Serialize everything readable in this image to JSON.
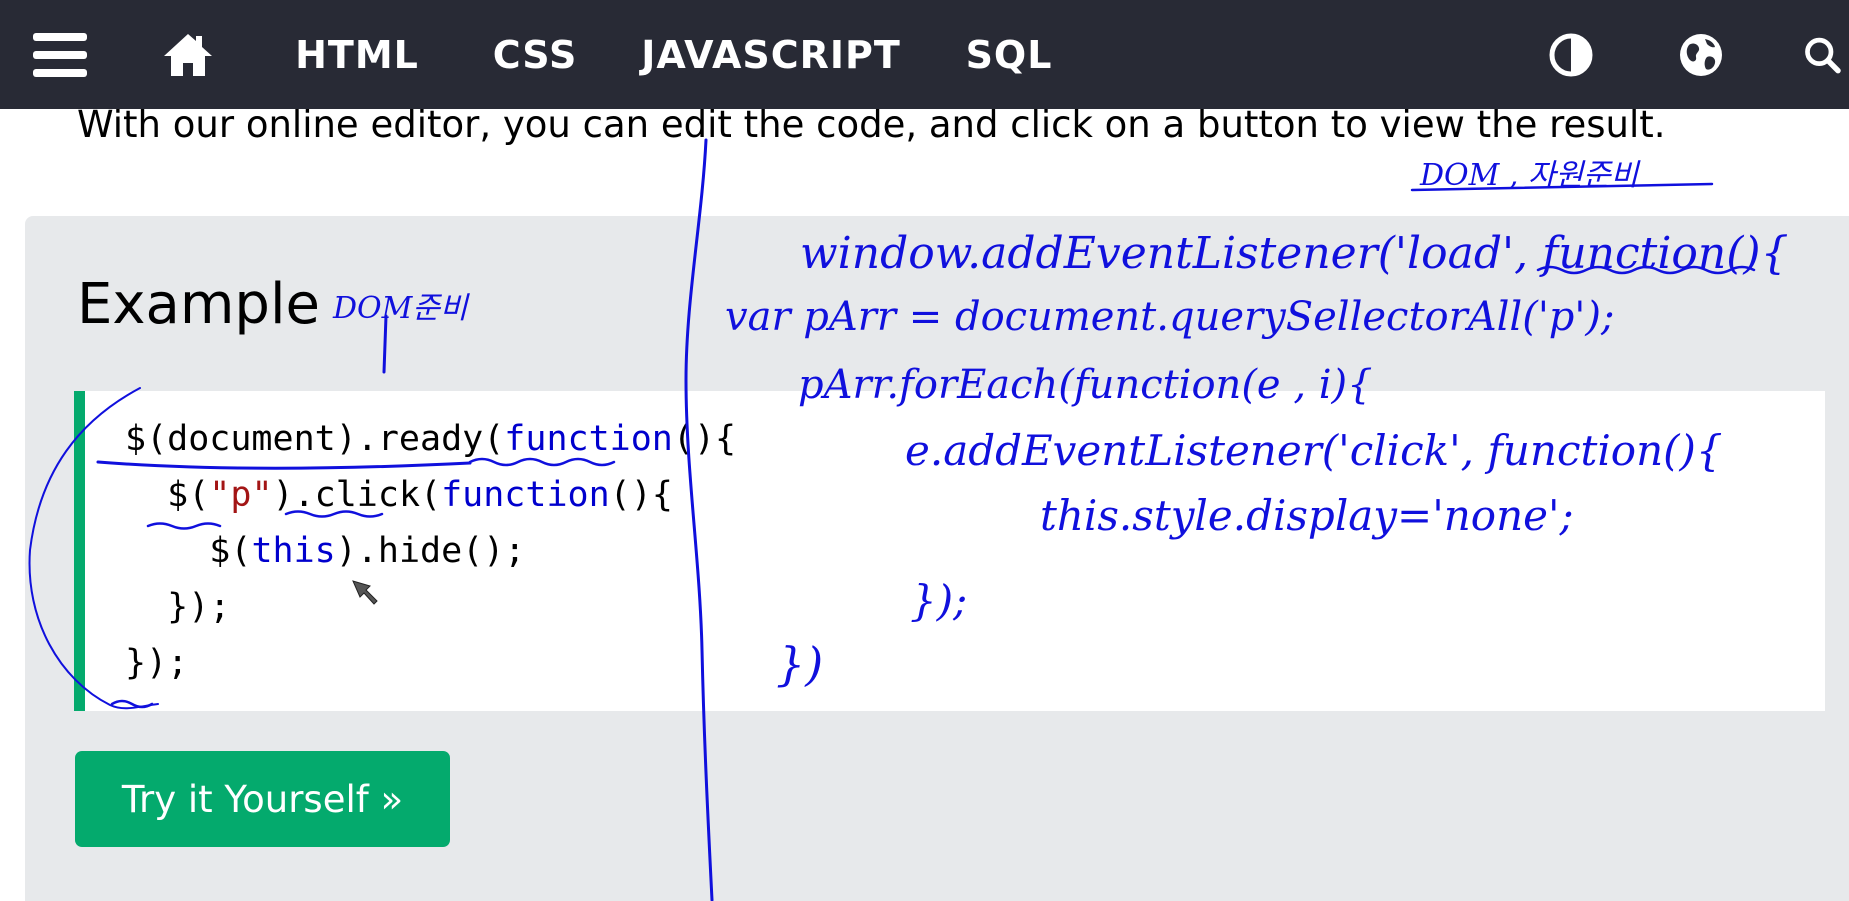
{
  "nav": {
    "items": [
      "HTML",
      "CSS",
      "JAVASCRIPT",
      "SQL"
    ],
    "icons": {
      "menu": "hamburger-menu-icon",
      "home": "home-icon",
      "theme": "contrast-icon",
      "language": "globe-icon",
      "search": "search-icon"
    }
  },
  "intro_text": "With our online editor, you can edit the code, and click on a button to view the result.",
  "example": {
    "title": "Example",
    "code": {
      "line1_a": "$(document).ready(",
      "line1_b": "function",
      "line1_c": "(){",
      "line2_a": "  $(",
      "line2_str": "\"p\"",
      "line2_b": ").click(",
      "line2_kw": "function",
      "line2_c": "(){",
      "line3_a": "    $(",
      "line3_kw": "this",
      "line3_b": ").hide();",
      "line4": "  });",
      "line5": "});"
    },
    "button_label": "Try it Yourself »"
  },
  "annotations": {
    "dom_ready_note": "DOM준비",
    "dom_resource_note": "DOM , 자원준비",
    "line1": "window.addEventListener('load', function(){",
    "line2": "var pArr = document.querySellectorAll('p');",
    "line3": "pArr.forEach(function(e , i){",
    "line4": "e.addEventListener('click', function(){",
    "line5": "this.style.display='none';",
    "line6": "});",
    "line7": "})"
  },
  "colors": {
    "nav_bg": "#282a35",
    "panel_bg": "#e7e9eb",
    "accent_green": "#04aa6d",
    "string_red": "#a31515",
    "keyword_blue": "#0000cd",
    "ink_blue": "#1010dd"
  }
}
